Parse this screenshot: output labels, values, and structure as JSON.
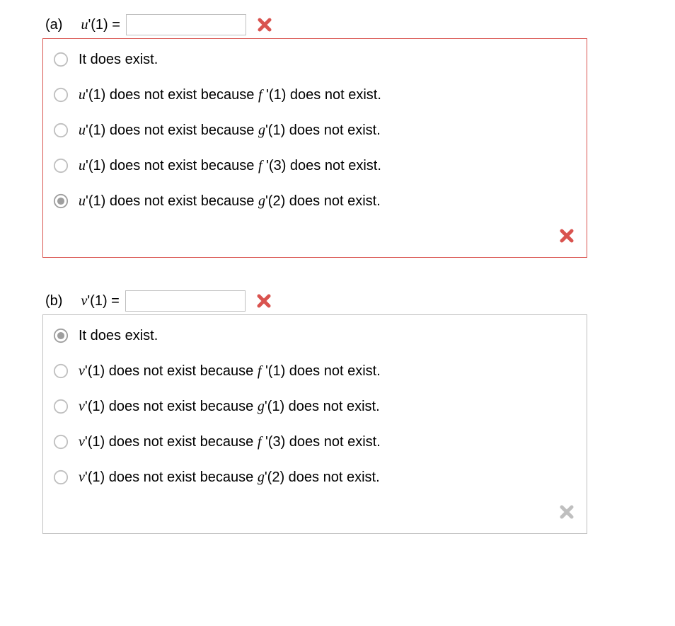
{
  "parts": [
    {
      "id": "a",
      "part_label": "(a)",
      "lhs_html": "<span class=\"math\">u</span>'(1) = ",
      "input_value": "",
      "input_status": "wrong",
      "box_status": "wrong",
      "options": [
        {
          "html": "It does exist.",
          "selected": false
        },
        {
          "html": "<span class=\"math\">u</span>'(1) does not exist because <span class=\"math\">f</span> '(1) does not exist.",
          "selected": false
        },
        {
          "html": "<span class=\"math\">u</span>'(1) does not exist because <span class=\"math\">g</span>'(1) does not exist.",
          "selected": false
        },
        {
          "html": "<span class=\"math\">u</span>'(1) does not exist because <span class=\"math\">f</span> '(3) does not exist.",
          "selected": false
        },
        {
          "html": "<span class=\"math\">u</span>'(1) does not exist because <span class=\"math\">g</span>'(2) does not exist.",
          "selected": true
        }
      ]
    },
    {
      "id": "b",
      "part_label": "(b)",
      "lhs_html": "<span class=\"math\">v</span>'(1) = ",
      "input_value": "",
      "input_status": "wrong",
      "box_status": "neutral",
      "options": [
        {
          "html": "It does exist.",
          "selected": true
        },
        {
          "html": "<span class=\"math\">v</span>'(1) does not exist because <span class=\"math\">f</span> '(1) does not exist.",
          "selected": false
        },
        {
          "html": "<span class=\"math\">v</span>'(1) does not exist because <span class=\"math\">g</span>'(1) does not exist.",
          "selected": false
        },
        {
          "html": "<span class=\"math\">v</span>'(1) does not exist because <span class=\"math\">f</span> '(3) does not exist.",
          "selected": false
        },
        {
          "html": "<span class=\"math\">v</span>'(1) does not exist because <span class=\"math\">g</span>'(2) does not exist.",
          "selected": false
        }
      ]
    }
  ],
  "icons": {
    "x_red": "#d9534f",
    "x_gray": "#bfbfbf"
  }
}
